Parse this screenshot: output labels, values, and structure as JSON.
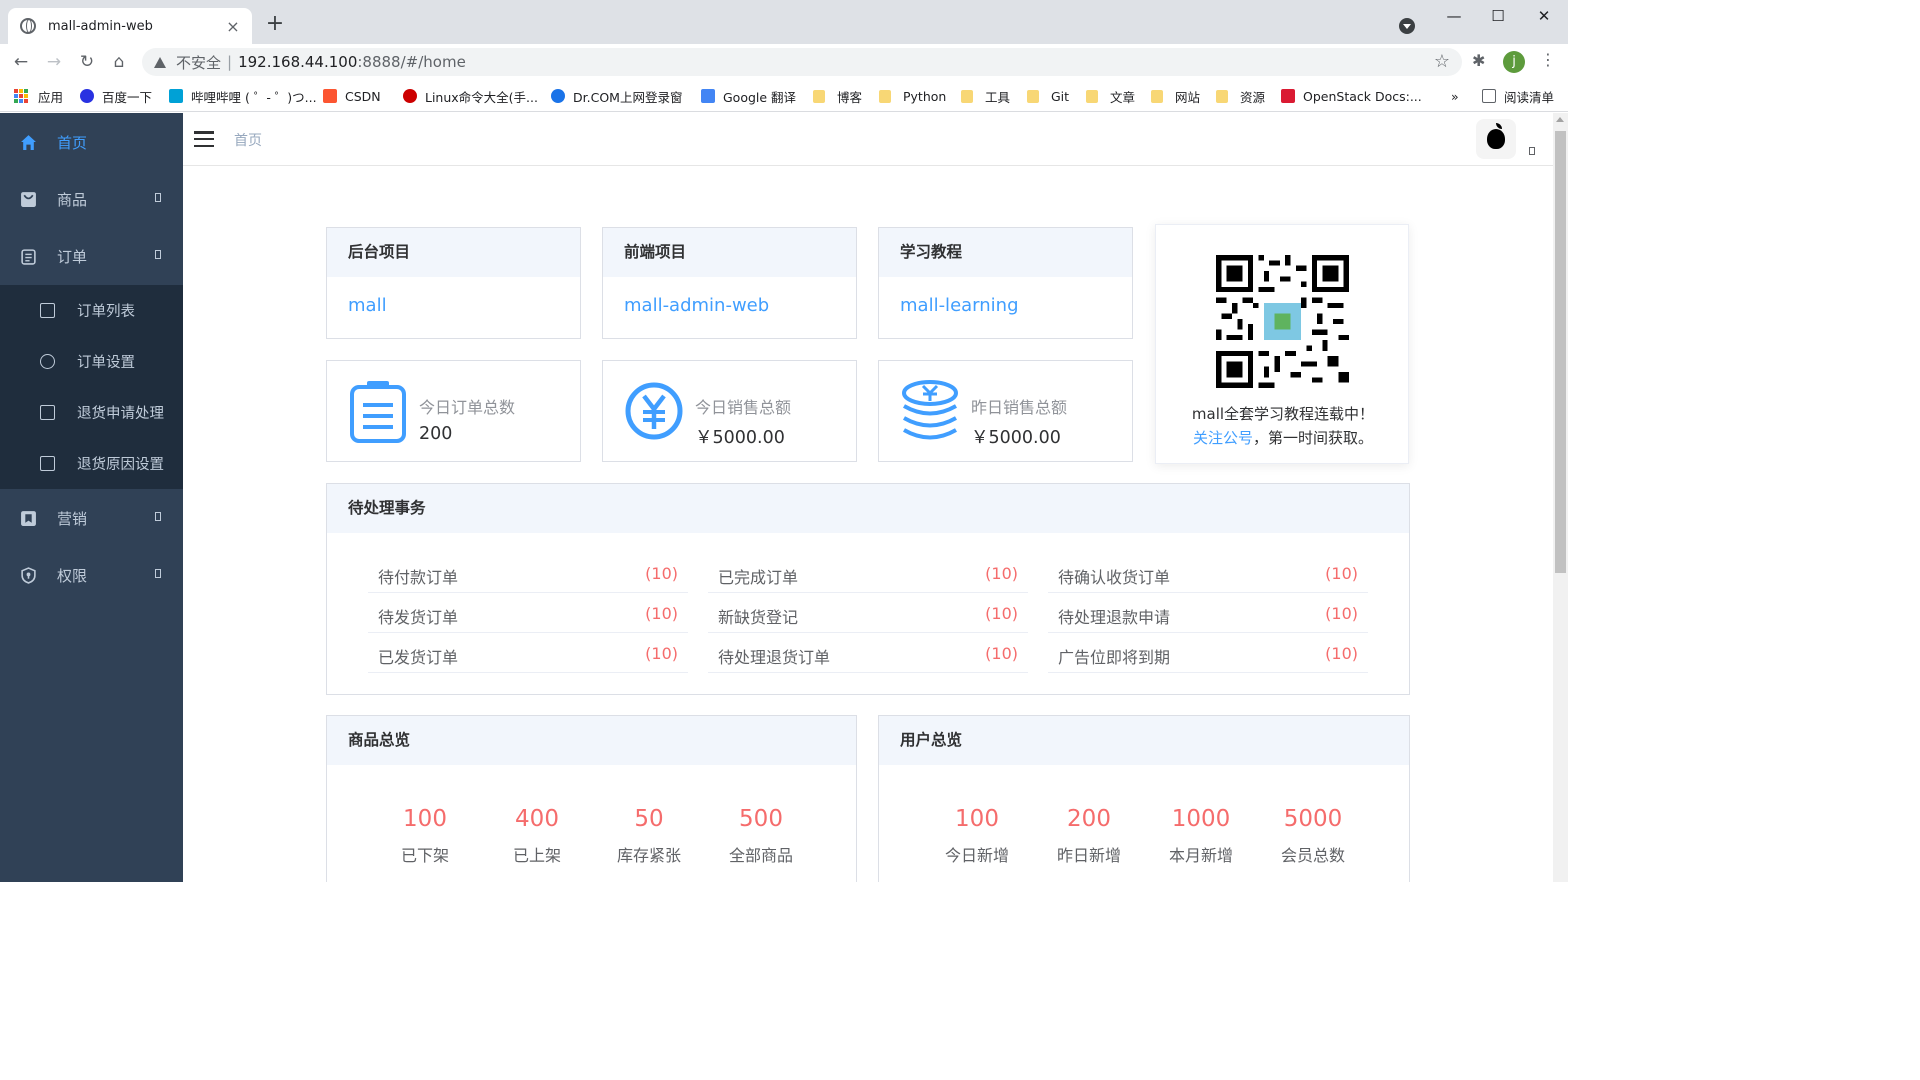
{
  "browser": {
    "tab_title": "mall-admin-web",
    "tab_close": "×",
    "new_tab": "+",
    "win_min": "—",
    "win_max": "☐",
    "win_close": "✕",
    "address": {
      "insecure": "不安全",
      "separator": "|",
      "host": "192.168.44.100",
      "path": ":8888/#/home"
    },
    "avatar_letter": "j",
    "bookmarks": [
      "应用",
      "百度一下",
      "哔哩哔哩 ( ゜- ゜)つ...",
      "CSDN",
      "Linux命令大全(手...",
      "Dr.COM上网登录窗",
      "Google 翻译",
      "博客",
      "Python",
      "工具",
      "Git",
      "文章",
      "网站",
      "资源",
      "OpenStack Docs:...",
      "»",
      "阅读清单"
    ]
  },
  "sidebar": {
    "items": [
      {
        "label": "首页",
        "icon": "home-icon"
      },
      {
        "label": "商品",
        "icon": "goods-icon"
      },
      {
        "label": "订单",
        "icon": "order-icon"
      },
      {
        "label": "营销",
        "icon": "marketing-icon"
      },
      {
        "label": "权限",
        "icon": "permission-icon"
      }
    ],
    "order_sub": [
      {
        "label": "订单列表",
        "icon": "list-icon"
      },
      {
        "label": "订单设置",
        "icon": "settings-icon"
      },
      {
        "label": "退货申请处理",
        "icon": "return-icon"
      },
      {
        "label": "退货原因设置",
        "icon": "reason-icon"
      }
    ]
  },
  "navbar": {
    "breadcrumb": "首页"
  },
  "links": [
    {
      "title": "后台项目",
      "link": "mall"
    },
    {
      "title": "前端项目",
      "link": "mall-admin-web"
    },
    {
      "title": "学习教程",
      "link": "mall-learning"
    }
  ],
  "stats": [
    {
      "label": "今日订单总数",
      "value": "200"
    },
    {
      "label": "今日销售总额",
      "value": "￥5000.00"
    },
    {
      "label": "昨日销售总额",
      "value": "￥5000.00"
    }
  ],
  "qr": {
    "line1": "mall全套学习教程连载中！",
    "follow": "关注公号",
    "rest": "，第一时间获取。"
  },
  "todo": {
    "title": "待处理事务",
    "items": [
      {
        "label": "待付款订单",
        "count": "(10)"
      },
      {
        "label": "已完成订单",
        "count": "(10)"
      },
      {
        "label": "待确认收货订单",
        "count": "(10)"
      },
      {
        "label": "待发货订单",
        "count": "(10)"
      },
      {
        "label": "新缺货登记",
        "count": "(10)"
      },
      {
        "label": "待处理退款申请",
        "count": "(10)"
      },
      {
        "label": "已发货订单",
        "count": "(10)"
      },
      {
        "label": "待处理退货订单",
        "count": "(10)"
      },
      {
        "label": "广告位即将到期",
        "count": "(10)"
      }
    ]
  },
  "product_overview": {
    "title": "商品总览",
    "items": [
      {
        "num": "100",
        "label": "已下架"
      },
      {
        "num": "400",
        "label": "已上架"
      },
      {
        "num": "50",
        "label": "库存紧张"
      },
      {
        "num": "500",
        "label": "全部商品"
      }
    ]
  },
  "user_overview": {
    "title": "用户总览",
    "items": [
      {
        "num": "100",
        "label": "今日新增"
      },
      {
        "num": "200",
        "label": "昨日新增"
      },
      {
        "num": "1000",
        "label": "本月新增"
      },
      {
        "num": "5000",
        "label": "会员总数"
      }
    ]
  },
  "colors": {
    "accent": "#409eff",
    "sidebar_bg": "#304156",
    "submenu_bg": "#1f2d3d",
    "count_red": "#f56c6c"
  }
}
